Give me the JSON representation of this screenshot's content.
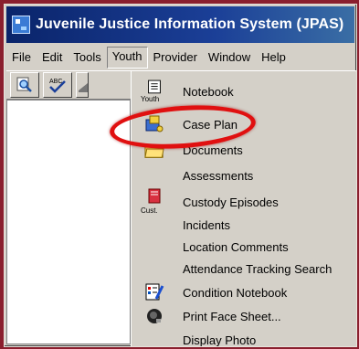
{
  "window": {
    "title": "Juvenile Justice Information System (JPAS)"
  },
  "menubar": {
    "items": [
      "File",
      "Edit",
      "Tools",
      "Youth",
      "Provider",
      "Window",
      "Help"
    ]
  },
  "youth_menu": {
    "items": [
      {
        "label": "Notebook",
        "icon": "notebook-icon",
        "icon_caption": "Youth"
      },
      {
        "label": "Case Plan",
        "icon": "case-plan-icon"
      },
      {
        "label": "Documents",
        "icon": "folder-icon"
      },
      {
        "label": "Assessments"
      },
      {
        "label": "Custody Episodes",
        "icon": "custody-book-icon",
        "icon_caption": "Cust."
      },
      {
        "label": "Incidents"
      },
      {
        "label": "Location Comments"
      },
      {
        "label": "Attendance Tracking Search"
      },
      {
        "label": "Condition Notebook",
        "icon": "condition-notebook-icon"
      },
      {
        "label": "Print Face Sheet...",
        "icon": "print-face-icon"
      },
      {
        "label": "Display Photo"
      }
    ]
  },
  "colors": {
    "title_bar": "#0a246a",
    "chrome": "#d4d0c8",
    "annotation_ring": "#e01010",
    "background": "#8a1f2e"
  }
}
